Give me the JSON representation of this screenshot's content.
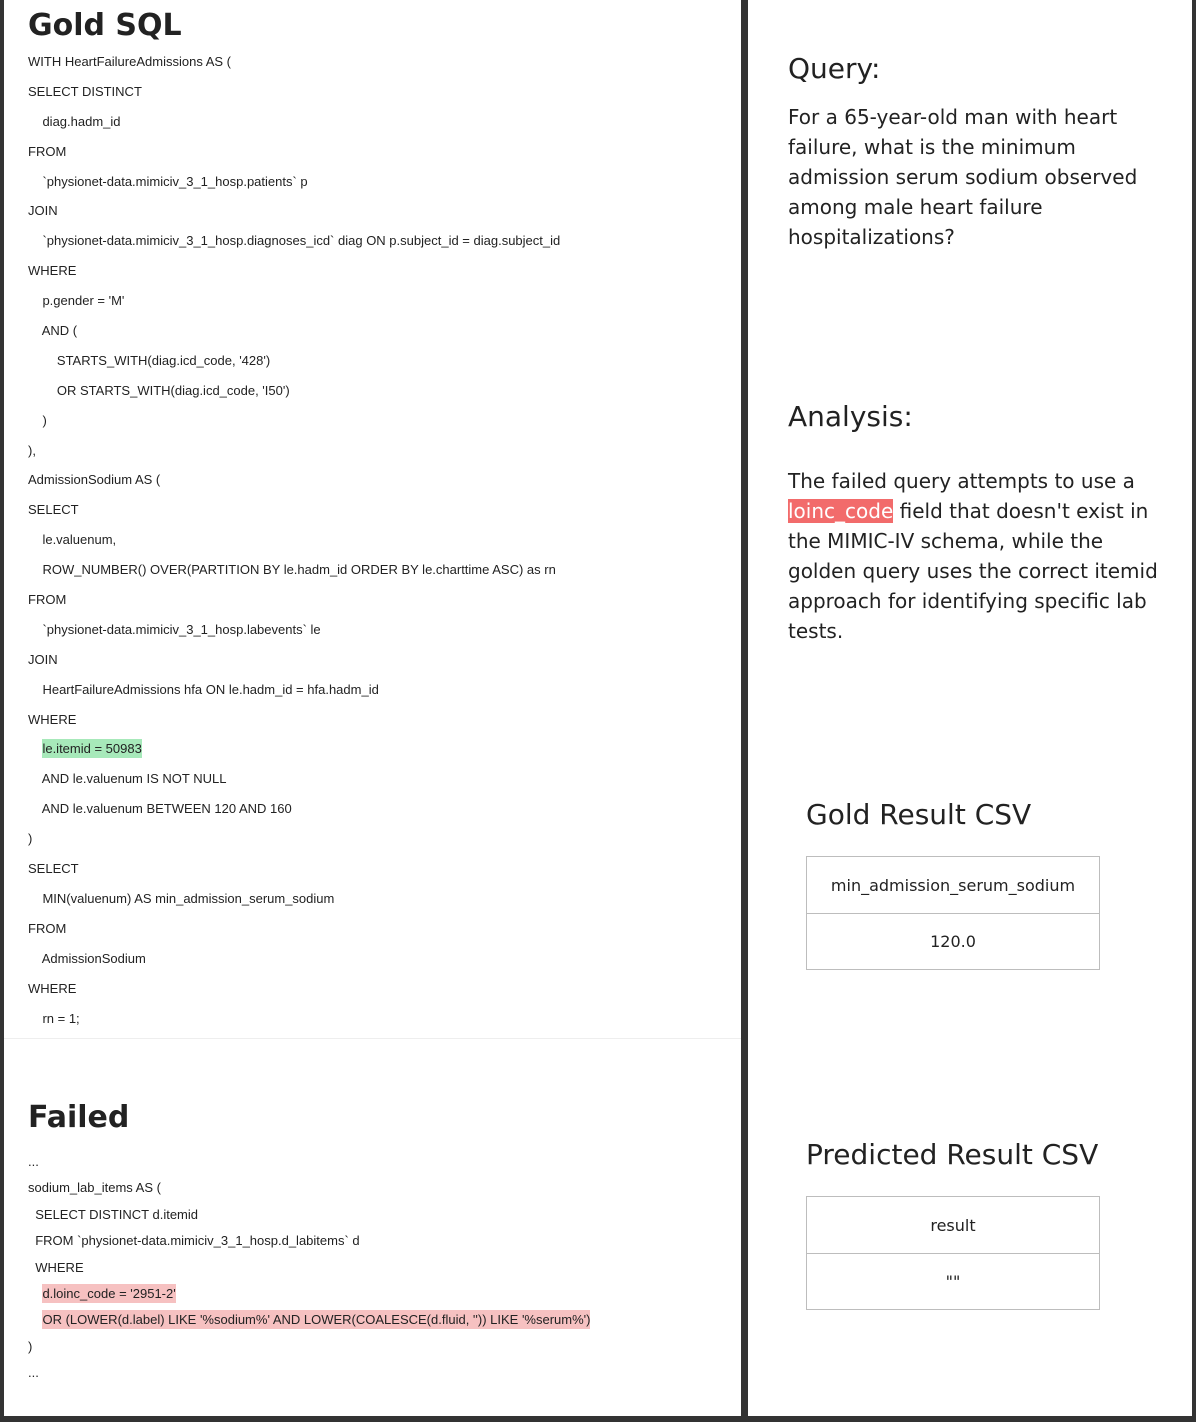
{
  "gold": {
    "title": "Gold SQL",
    "lines": [
      "WITH HeartFailureAdmissions AS (",
      "SELECT DISTINCT",
      "    diag.hadm_id",
      "FROM",
      "    `physionet-data.mimiciv_3_1_hosp.patients` p",
      "JOIN",
      "    `physionet-data.mimiciv_3_1_hosp.diagnoses_icd` diag ON p.subject_id = diag.subject_id",
      "WHERE",
      "    p.gender = 'M'",
      "    AND (",
      "        STARTS_WITH(diag.icd_code, '428')",
      "        OR STARTS_WITH(diag.icd_code, 'I50')",
      "    )",
      "),",
      "AdmissionSodium AS (",
      "SELECT",
      "    le.valuenum,",
      "    ROW_NUMBER() OVER(PARTITION BY le.hadm_id ORDER BY le.charttime ASC) as rn",
      "FROM",
      "    `physionet-data.mimiciv_3_1_hosp.labevents` le",
      "JOIN",
      "    HeartFailureAdmissions hfa ON le.hadm_id = hfa.hadm_id",
      "WHERE",
      "    le.itemid = 50983",
      "    AND le.valuenum IS NOT NULL",
      "    AND le.valuenum BETWEEN 120 AND 160",
      ")",
      "SELECT",
      "    MIN(valuenum) AS min_admission_serum_sodium",
      "FROM",
      "    AdmissionSodium",
      "WHERE",
      "    rn = 1;"
    ]
  },
  "failed": {
    "title": "Failed",
    "lines": [
      "...",
      "sodium_lab_items AS (",
      "  SELECT DISTINCT d.itemid",
      "  FROM `physionet-data.mimiciv_3_1_hosp.d_labitems` d",
      "  WHERE",
      "    d.loinc_code = '2951-2'",
      "    OR (LOWER(d.label) LIKE '%sodium%' AND LOWER(COALESCE(d.fluid, '')) LIKE '%serum%')",
      ")",
      "..."
    ]
  },
  "query": {
    "heading": "Query:",
    "text": "For a 65-year-old man with heart failure, what is the minimum admission serum sodium observed among male heart failure hospitalizations?"
  },
  "analysis": {
    "heading": "Analysis:",
    "text_before": "The failed query attempts to use a ",
    "highlight": "loinc_code",
    "text_after": " field that doesn't exist in the MIMIC-IV schema, while the golden query uses the correct itemid approach for identifying specific lab tests."
  },
  "gold_result": {
    "title": "Gold Result CSV",
    "header": "min_admission_serum_sodium",
    "value": "120.0"
  },
  "predicted_result": {
    "title": "Predicted Result CSV",
    "header": "result",
    "value": "\"\""
  },
  "colors": {
    "green_highlight": "#a7e9ba",
    "red_highlight": "#f6c1c1",
    "analysis_chip": "#f26b6b"
  }
}
